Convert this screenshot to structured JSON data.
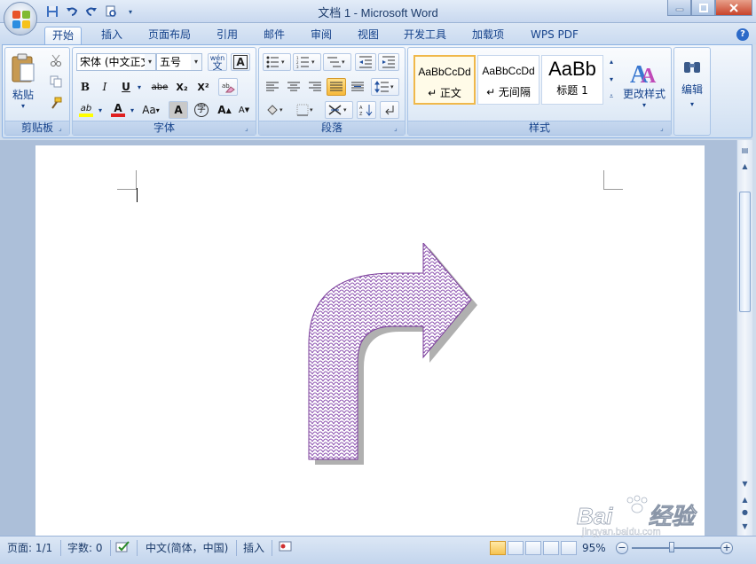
{
  "window": {
    "title": "文档 1 - Microsoft Word"
  },
  "tabs": [
    {
      "label": "开始",
      "active": true
    },
    {
      "label": "插入"
    },
    {
      "label": "页面布局"
    },
    {
      "label": "引用"
    },
    {
      "label": "邮件"
    },
    {
      "label": "审阅"
    },
    {
      "label": "视图"
    },
    {
      "label": "开发工具"
    },
    {
      "label": "加载项"
    },
    {
      "label": "WPS PDF"
    }
  ],
  "ribbon": {
    "clipboard": {
      "label": "剪贴板",
      "paste_label": "粘贴"
    },
    "font": {
      "label": "字体",
      "font_name": "宋体 (中文正文)",
      "font_size": "五号",
      "phonetic_label": "wén",
      "bold": "B",
      "italic": "I",
      "underline": "U",
      "strike": "abe",
      "subscript": "X₂",
      "superscript": "X²",
      "highlight": "ab",
      "font_color": "A",
      "change_case": "Aa",
      "char_shade": "A",
      "enclose": "字",
      "grow": "A",
      "shrink": "A"
    },
    "paragraph": {
      "label": "段落"
    },
    "styles": {
      "label": "样式",
      "items": [
        {
          "sample": "AaBbCcDd",
          "name": "↵ 正文",
          "active": true
        },
        {
          "sample": "AaBbCcDd",
          "name": "↵ 无间隔"
        },
        {
          "sample": "AaBb",
          "name": "标题 1"
        }
      ],
      "change_styles_label": "更改样式"
    },
    "editing": {
      "label": "编辑"
    }
  },
  "statusbar": {
    "page": "页面: 1/1",
    "words": "字数: 0",
    "language": "中文(简体，中国)",
    "mode": "插入",
    "zoom": "95%"
  },
  "watermark": {
    "brand": "Bai",
    "sub": "经验",
    "url": "jingyan.baidu.com"
  },
  "colors": {
    "arrow_outline": "#7a3d9a",
    "arrow_pattern": "#8a4fae",
    "arrow_shadow": "#b0b0b0",
    "highlight_yellow": "#ffff00",
    "font_red": "#e02020"
  }
}
